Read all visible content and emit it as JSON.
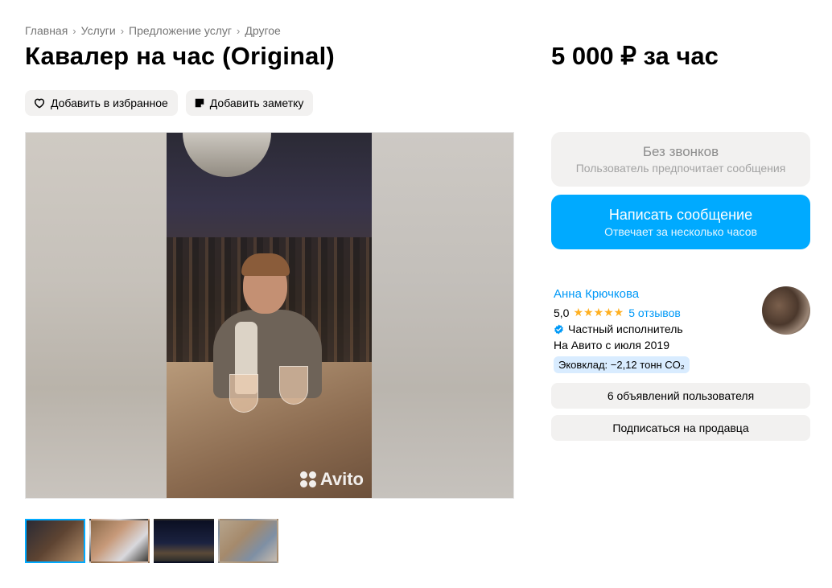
{
  "breadcrumb": {
    "items": [
      "Главная",
      "Услуги",
      "Предложение услуг",
      "Другое"
    ],
    "separator": "›"
  },
  "listing": {
    "title": "Кавалер на час (Original)",
    "price": "5 000 ₽ за час"
  },
  "actions": {
    "favorite_label": "Добавить в избранное",
    "note_label": "Добавить заметку"
  },
  "gallery": {
    "watermark": "Avito",
    "thumbnail_count": 4,
    "active_index": 0
  },
  "contact": {
    "no_calls_title": "Без звонков",
    "no_calls_subtitle": "Пользователь предпочитает сообщения",
    "message_button_title": "Написать сообщение",
    "message_button_subtitle": "Отвечает за несколько часов"
  },
  "seller": {
    "name": "Анна Крючкова",
    "rating": "5,0",
    "stars": "★★★★★",
    "reviews": "5 отзывов",
    "type": "Частный исполнитель",
    "since": "На Авито с июля 2019",
    "eco": "Эковклад: −2,12 тонн CO₂",
    "listings_button": "6 объявлений пользователя",
    "subscribe_button": "Подписаться на продавца"
  },
  "colors": {
    "accent": "#00aaff",
    "link": "#0099f7",
    "star": "#ffb021",
    "button_bg": "#f2f1f0"
  },
  "icons": {
    "favorite": "heart-icon",
    "note": "note-icon",
    "verified": "verified-check-icon"
  }
}
